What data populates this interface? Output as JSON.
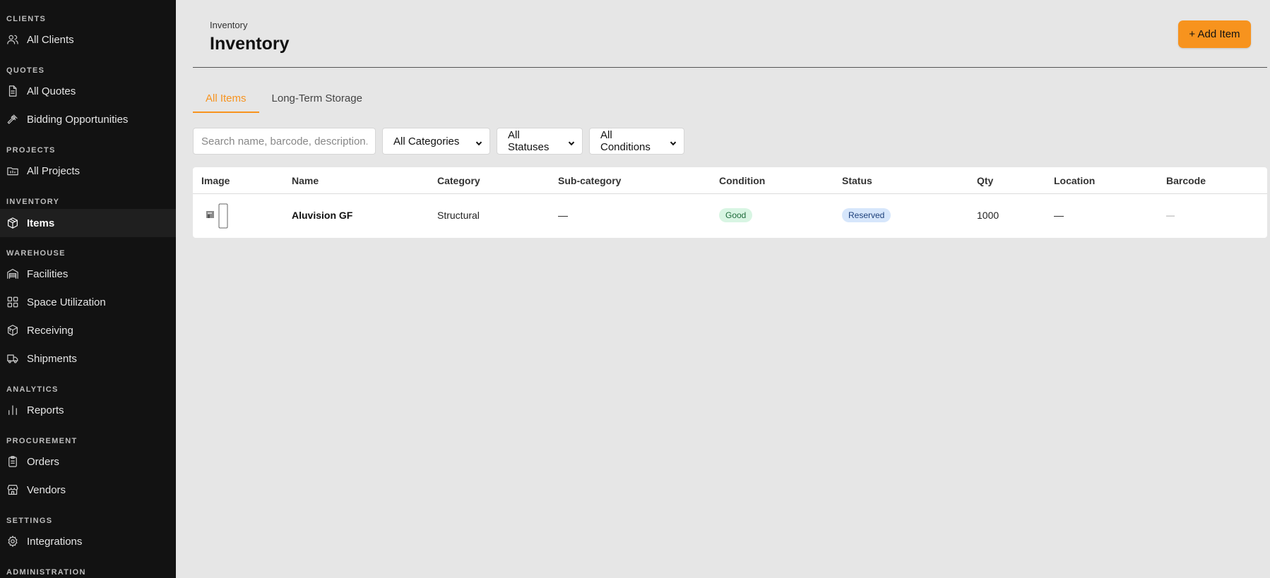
{
  "sidebar": {
    "sections": [
      {
        "title": "CLIENTS",
        "items": [
          {
            "label": "All Clients",
            "icon": "users-icon"
          }
        ]
      },
      {
        "title": "QUOTES",
        "items": [
          {
            "label": "All Quotes",
            "icon": "document-icon"
          },
          {
            "label": "Bidding Opportunities",
            "icon": "gavel-icon"
          }
        ]
      },
      {
        "title": "PROJECTS",
        "items": [
          {
            "label": "All Projects",
            "icon": "folder-chart-icon"
          }
        ]
      },
      {
        "title": "INVENTORY",
        "items": [
          {
            "label": "Items",
            "icon": "cube-icon",
            "active": true
          }
        ]
      },
      {
        "title": "WAREHOUSE",
        "items": [
          {
            "label": "Facilities",
            "icon": "building-icon"
          },
          {
            "label": "Space Utilization",
            "icon": "grid-icon"
          },
          {
            "label": "Receiving",
            "icon": "package-icon"
          },
          {
            "label": "Shipments",
            "icon": "truck-icon"
          }
        ]
      },
      {
        "title": "ANALYTICS",
        "items": [
          {
            "label": "Reports",
            "icon": "bar-chart-icon"
          }
        ]
      },
      {
        "title": "PROCUREMENT",
        "items": [
          {
            "label": "Orders",
            "icon": "clipboard-icon"
          },
          {
            "label": "Vendors",
            "icon": "store-icon"
          }
        ]
      },
      {
        "title": "SETTINGS",
        "items": [
          {
            "label": "Integrations",
            "icon": "gear-icon"
          }
        ]
      },
      {
        "title": "ADMINISTRATION",
        "items": []
      }
    ]
  },
  "header": {
    "breadcrumb": "Inventory",
    "title": "Inventory",
    "add_button": "+ Add Item"
  },
  "tabs": [
    {
      "label": "All Items",
      "active": true
    },
    {
      "label": "Long-Term Storage",
      "active": false
    }
  ],
  "filters": {
    "search_placeholder": "Search name, barcode, description...",
    "category": "All Categories",
    "status": "All Statuses",
    "condition": "All Conditions"
  },
  "table": {
    "columns": [
      "Image",
      "Name",
      "Category",
      "Sub-category",
      "Condition",
      "Status",
      "Qty",
      "Location",
      "Barcode"
    ],
    "rows": [
      {
        "name": "Aluvision GF",
        "category": "Structural",
        "subcategory": "—",
        "condition": "Good",
        "status": "Reserved",
        "qty": "1000",
        "location": "—",
        "barcode": "—"
      }
    ]
  },
  "colors": {
    "accent": "#f7931e",
    "sidebar_bg": "#121212",
    "page_bg": "#e6e6e6",
    "good_bg": "#d8f5e3",
    "reserved_bg": "#d6e6fb"
  }
}
